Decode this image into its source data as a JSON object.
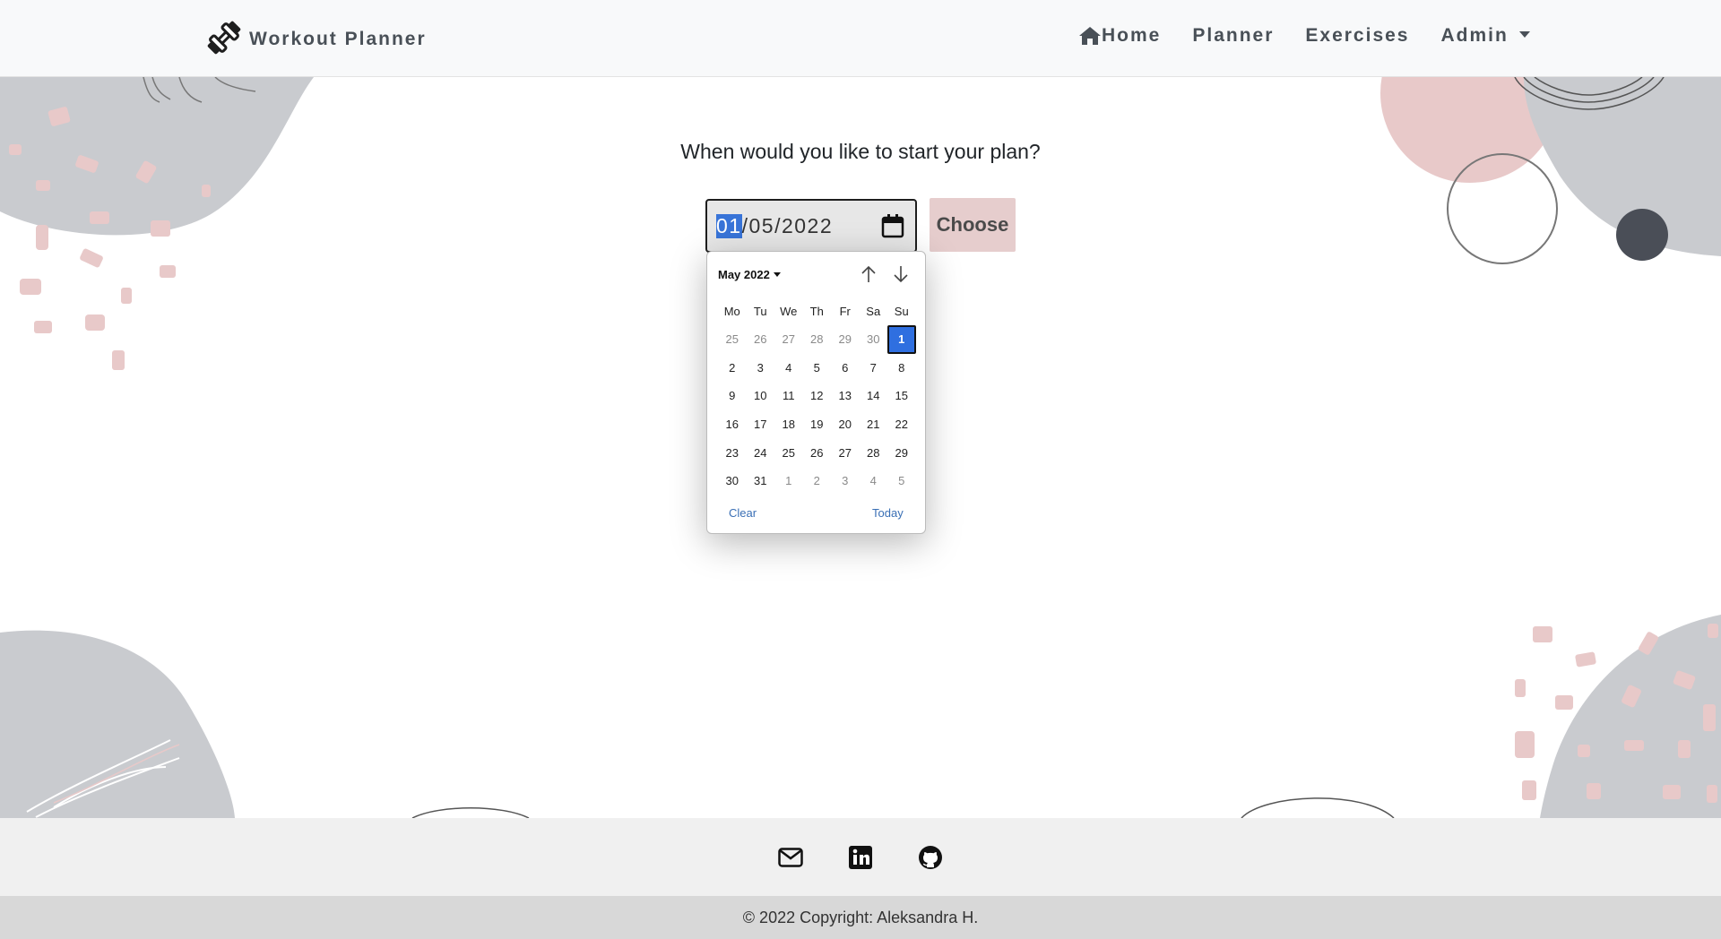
{
  "navbar": {
    "brand": "Workout Planner",
    "links": [
      {
        "label": "Home"
      },
      {
        "label": "Planner"
      },
      {
        "label": "Exercises"
      },
      {
        "label": "Admin"
      }
    ]
  },
  "main": {
    "question": "When would you like to start your plan?",
    "date_input": {
      "day": "01",
      "rest": "/05/2022"
    },
    "choose_label": "Choose"
  },
  "datepicker": {
    "month_label": "May 2022",
    "weekdays": [
      "Mo",
      "Tu",
      "We",
      "Th",
      "Fr",
      "Sa",
      "Su"
    ],
    "weeks": [
      [
        "25",
        "26",
        "27",
        "28",
        "29",
        "30",
        "1"
      ],
      [
        "2",
        "3",
        "4",
        "5",
        "6",
        "7",
        "8"
      ],
      [
        "9",
        "10",
        "11",
        "12",
        "13",
        "14",
        "15"
      ],
      [
        "16",
        "17",
        "18",
        "19",
        "20",
        "21",
        "22"
      ],
      [
        "23",
        "24",
        "25",
        "26",
        "27",
        "28",
        "29"
      ],
      [
        "30",
        "31",
        "1",
        "2",
        "3",
        "4",
        "5"
      ]
    ],
    "selected": "1",
    "clear_label": "Clear",
    "today_label": "Today"
  },
  "footer": {
    "icons": [
      "envelope-icon",
      "linkedin-icon",
      "github-icon"
    ],
    "copyright": "© 2022 Copyright: Aleksandra H."
  },
  "colors": {
    "accent_button": "#e6cdcd",
    "selected_day": "#2f6fe0",
    "link": "#3a6fb5",
    "decor_gray": "#c9cbcf",
    "decor_pink": "#e8c9c9"
  }
}
